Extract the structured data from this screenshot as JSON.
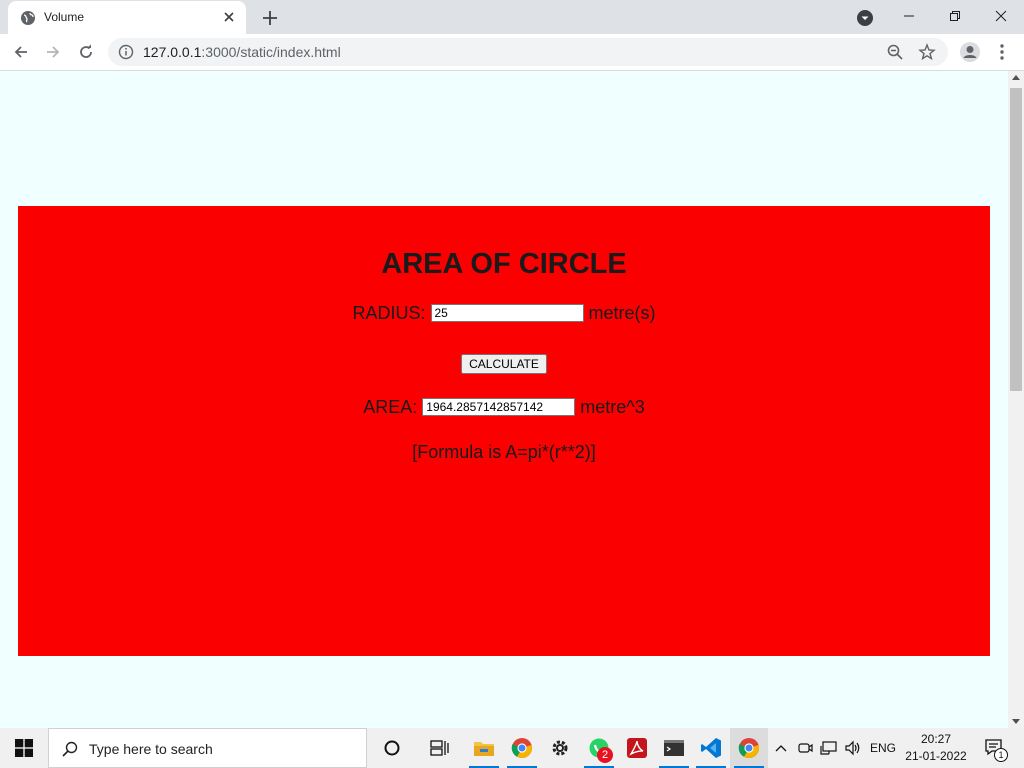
{
  "browser": {
    "tab": {
      "title": "Volume"
    },
    "url": {
      "host": "127.0.0.1",
      "path": ":3000/static/index.html"
    }
  },
  "page": {
    "background": "#f0ffff",
    "panel_color": "#fa0000",
    "heading": "AREA OF CIRCLE",
    "radius": {
      "label": "RADIUS:",
      "value": "25",
      "unit": "metre(s)"
    },
    "calculate_label": "CALCULATE",
    "area": {
      "label": "AREA:",
      "value": "1964.2857142857142",
      "unit": "metre^3"
    },
    "formula": "[Formula is A=pi*(r**2)]"
  },
  "taskbar": {
    "search_placeholder": "Type here to search",
    "whatsapp_badge": "2",
    "language": "ENG",
    "time": "20:27",
    "date": "21-01-2022",
    "notification_count": "1"
  }
}
